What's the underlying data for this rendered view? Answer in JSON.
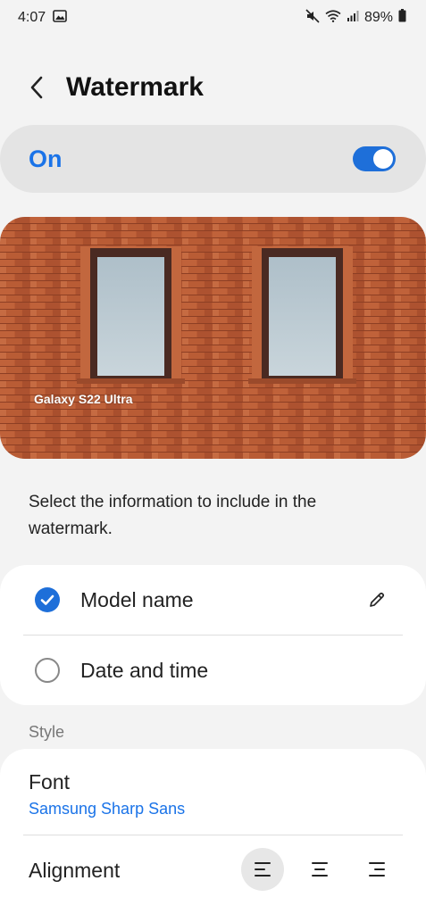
{
  "status": {
    "time": "4:07",
    "battery": "89%"
  },
  "header": {
    "title": "Watermark"
  },
  "toggle": {
    "label": "On",
    "enabled": true
  },
  "preview": {
    "watermark_text": "Galaxy S22 Ultra"
  },
  "description": "Select the information to include in the watermark.",
  "options": [
    {
      "label": "Model name",
      "checked": true
    },
    {
      "label": "Date and time",
      "checked": false
    }
  ],
  "style": {
    "section_label": "Style",
    "font_title": "Font",
    "font_value": "Samsung Sharp Sans",
    "alignment_title": "Alignment",
    "alignment_selected": "left"
  },
  "colors": {
    "accent": "#1e6fd9",
    "brick": "#b8562f",
    "background": "#f3f3f3"
  }
}
